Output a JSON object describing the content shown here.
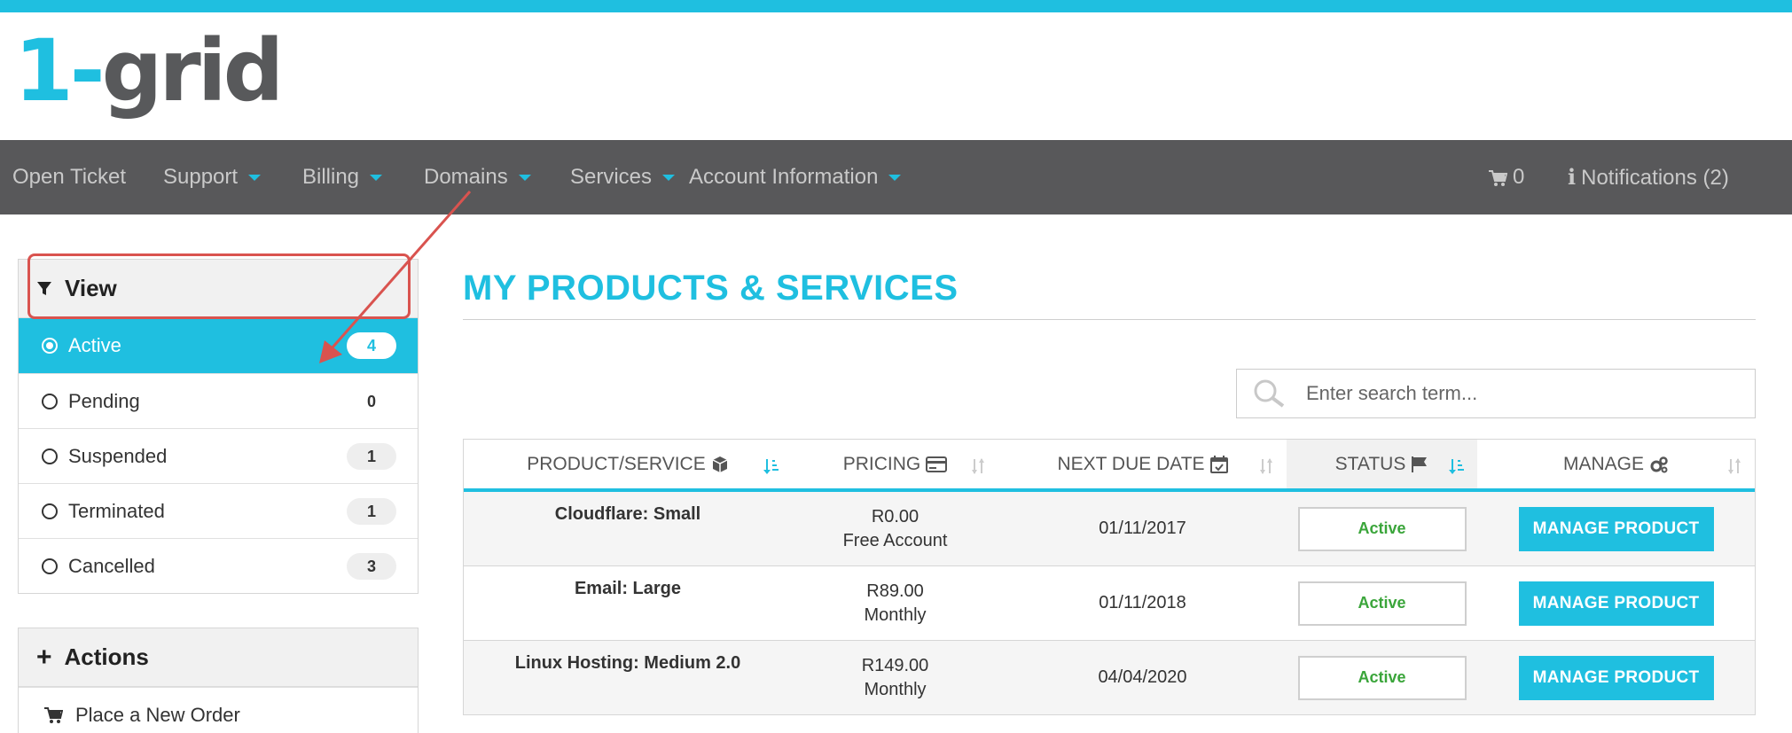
{
  "brand": {
    "logo_accent": "1-",
    "logo_text": "grid",
    "accent_color": "#1fbfe0",
    "nav_bg": "#58585a"
  },
  "nav": {
    "items": [
      {
        "label": "Open Ticket",
        "dropdown": false
      },
      {
        "label": "Support",
        "dropdown": true
      },
      {
        "label": "Billing",
        "dropdown": true
      },
      {
        "label": "Domains",
        "dropdown": true
      },
      {
        "label": "Services",
        "dropdown": true
      },
      {
        "label": "Account Information",
        "dropdown": true
      }
    ],
    "cart_count": "0",
    "notifications": "Notifications (2)"
  },
  "sidebar": {
    "view_title": "View",
    "view_items": [
      {
        "label": "Active",
        "count": "4",
        "selected": true
      },
      {
        "label": "Pending",
        "count": "0",
        "selected": false
      },
      {
        "label": "Suspended",
        "count": "1",
        "selected": false
      },
      {
        "label": "Terminated",
        "count": "1",
        "selected": false
      },
      {
        "label": "Cancelled",
        "count": "3",
        "selected": false
      }
    ],
    "actions_title": "Actions",
    "action_items": [
      {
        "label": "Place a New Order",
        "icon": "cart-icon"
      }
    ]
  },
  "main": {
    "title": "MY PRODUCTS & SERVICES",
    "search_placeholder": "Enter search term...",
    "columns": [
      {
        "label": "PRODUCT/SERVICE",
        "icon": "cube-icon"
      },
      {
        "label": "PRICING",
        "icon": "credit-card-icon"
      },
      {
        "label": "NEXT DUE DATE",
        "icon": "calendar-icon"
      },
      {
        "label": "STATUS",
        "icon": "flag-icon"
      },
      {
        "label": "MANAGE",
        "icon": "gears-icon"
      }
    ],
    "rows": [
      {
        "product": "Cloudflare: Small",
        "price": "R0.00",
        "cycle": "Free Account",
        "due": "01/11/2017",
        "status": "Active",
        "action": "MANAGE PRODUCT"
      },
      {
        "product": "Email: Large",
        "price": "R89.00",
        "cycle": "Monthly",
        "due": "01/11/2018",
        "status": "Active",
        "action": "MANAGE PRODUCT"
      },
      {
        "product": "Linux Hosting: Medium 2.0",
        "price": "R149.00",
        "cycle": "Monthly",
        "due": "04/04/2020",
        "status": "Active",
        "action": "MANAGE PRODUCT"
      }
    ]
  }
}
